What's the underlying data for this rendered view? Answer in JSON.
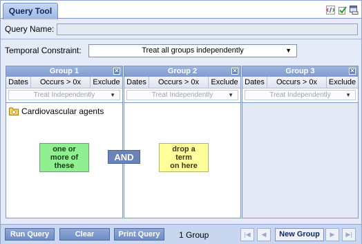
{
  "tab": {
    "title": "Query Tool"
  },
  "toolbar": {
    "icons": [
      "xml-icon",
      "check-icon",
      "window-icon"
    ]
  },
  "query_name": {
    "label": "Query Name:",
    "value": ""
  },
  "temporal": {
    "label": "Temporal Constraint:",
    "selected": "Treat all groups independently"
  },
  "columns": {
    "dates": "Dates",
    "occurs": "Occurs > 0x",
    "exclude": "Exclude"
  },
  "groups": [
    {
      "title": "Group 1",
      "timing": "Treat Independently",
      "terms": [
        "Cardiovascular agents"
      ],
      "hint": [
        "one or",
        "more of",
        "these"
      ]
    },
    {
      "title": "Group 2",
      "timing": "Treat Independently",
      "terms": [],
      "hint": [
        "drop a",
        "term",
        "on here"
      ]
    },
    {
      "title": "Group 3",
      "timing": "Treat Independently",
      "terms": []
    }
  ],
  "connector": "AND",
  "footer": {
    "run": "Run Query",
    "clear": "Clear",
    "print": "Print Query",
    "group_count": "1 Group",
    "new_group": "New Group"
  },
  "colors": {
    "hint_green": "#90ef90",
    "hint_yellow": "#ffff9c",
    "accent": "#6b84b5"
  }
}
